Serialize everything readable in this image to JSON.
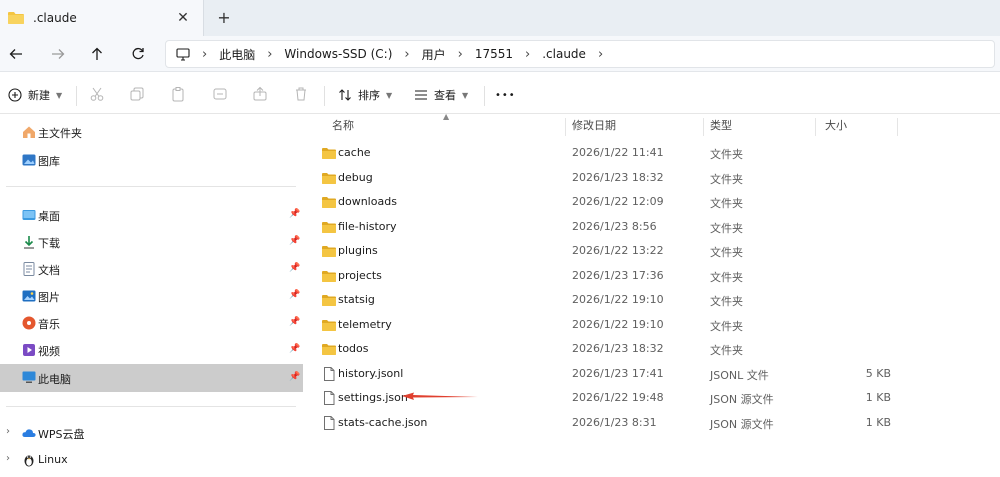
{
  "tab": {
    "title": ".claude",
    "close": "✕",
    "new_tab": "+"
  },
  "nav": {
    "breadcrumb": [
      "此电脑",
      "Windows-SSD (C:)",
      "用户",
      "17551",
      ".claude"
    ]
  },
  "toolbar": {
    "new_label": "新建",
    "sort_label": "排序",
    "view_label": "查看",
    "more_label": "•••"
  },
  "sidebar": {
    "top_items": [
      {
        "label": "主文件夹",
        "icon": "home-icon"
      },
      {
        "label": "图库",
        "icon": "gallery-icon"
      }
    ],
    "quick_access": [
      {
        "label": "桌面",
        "icon": "desktop-icon",
        "pinned": true
      },
      {
        "label": "下载",
        "icon": "download-icon",
        "pinned": true
      },
      {
        "label": "文档",
        "icon": "document-icon",
        "pinned": true
      },
      {
        "label": "图片",
        "icon": "pictures-icon",
        "pinned": true
      },
      {
        "label": "音乐",
        "icon": "music-icon",
        "pinned": true
      },
      {
        "label": "视频",
        "icon": "video-icon",
        "pinned": true
      },
      {
        "label": "此电脑",
        "icon": "computer-icon",
        "pinned": true,
        "selected": true
      }
    ],
    "locations": [
      {
        "label": "WPS云盘",
        "icon": "cloud-icon"
      },
      {
        "label": "Linux",
        "icon": "linux-icon"
      }
    ]
  },
  "columns": {
    "name": "名称",
    "modified": "修改日期",
    "type": "类型",
    "size": "大小"
  },
  "files": [
    {
      "name": "cache",
      "modified": "2026/1/22 11:41",
      "type": "文件夹",
      "size": "",
      "kind": "folder"
    },
    {
      "name": "debug",
      "modified": "2026/1/23 18:32",
      "type": "文件夹",
      "size": "",
      "kind": "folder"
    },
    {
      "name": "downloads",
      "modified": "2026/1/22 12:09",
      "type": "文件夹",
      "size": "",
      "kind": "folder"
    },
    {
      "name": "file-history",
      "modified": "2026/1/23 8:56",
      "type": "文件夹",
      "size": "",
      "kind": "folder"
    },
    {
      "name": "plugins",
      "modified": "2026/1/22 13:22",
      "type": "文件夹",
      "size": "",
      "kind": "folder"
    },
    {
      "name": "projects",
      "modified": "2026/1/23 17:36",
      "type": "文件夹",
      "size": "",
      "kind": "folder"
    },
    {
      "name": "statsig",
      "modified": "2026/1/22 19:10",
      "type": "文件夹",
      "size": "",
      "kind": "folder"
    },
    {
      "name": "telemetry",
      "modified": "2026/1/22 19:10",
      "type": "文件夹",
      "size": "",
      "kind": "folder"
    },
    {
      "name": "todos",
      "modified": "2026/1/23 18:32",
      "type": "文件夹",
      "size": "",
      "kind": "folder"
    },
    {
      "name": "history.jsonl",
      "modified": "2026/1/23 17:41",
      "type": "JSONL 文件",
      "size": "5 KB",
      "kind": "file"
    },
    {
      "name": "settings.json",
      "modified": "2026/1/22 19:48",
      "type": "JSON 源文件",
      "size": "1 KB",
      "kind": "file"
    },
    {
      "name": "stats-cache.json",
      "modified": "2026/1/23 8:31",
      "type": "JSON 源文件",
      "size": "1 KB",
      "kind": "file"
    }
  ],
  "colors": {
    "folder": "#f4c542",
    "folder_dark": "#e0a923",
    "annotation_arrow": "#e0402f",
    "selected_bg": "#cccccc"
  }
}
